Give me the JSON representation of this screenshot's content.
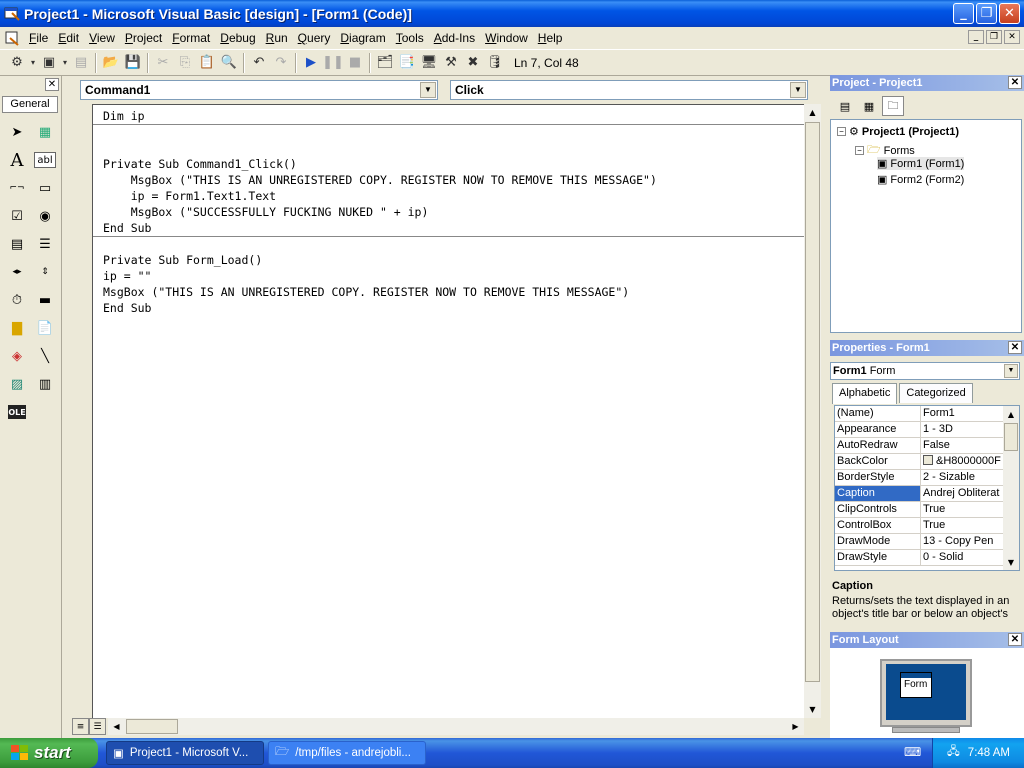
{
  "window": {
    "title": "Project1 - Microsoft Visual Basic [design] - [Form1 (Code)]",
    "min_glyph": "_",
    "max_glyph": "❐",
    "close_glyph": "✕"
  },
  "menu": {
    "items": [
      "File",
      "Edit",
      "View",
      "Project",
      "Format",
      "Debug",
      "Run",
      "Query",
      "Diagram",
      "Tools",
      "Add-Ins",
      "Window",
      "Help"
    ],
    "mdi_min": "_",
    "mdi_restore": "❐",
    "mdi_close": "✕"
  },
  "toolbar": {
    "position": "Ln 7, Col 48"
  },
  "toolbox": {
    "close_glyph": "✕",
    "general_label": "General"
  },
  "code": {
    "object_combo": "Command1",
    "procedure_combo": "Click",
    "lines": [
      "Dim ip",
      "Private Sub Command1_Click()",
      "    MsgBox (\"THIS IS AN UNREGISTERED COPY. REGISTER NOW TO REMOVE THIS MESSAGE\")",
      "    ip = Form1.Text1.Text",
      "    MsgBox (\"SUCCESSFULLY FUCKING NUKED \" + ip)",
      "End Sub",
      "Private Sub Form_Load()",
      "ip = \"\"",
      "MsgBox (\"THIS IS AN UNREGISTERED COPY. REGISTER NOW TO REMOVE THIS MESSAGE\")",
      "End Sub"
    ]
  },
  "project_explorer": {
    "title": "Project - Project1",
    "close_glyph": "✕",
    "root": "Project1 (Project1)",
    "folder": "Forms",
    "items": [
      "Form1 (Form1)",
      "Form2 (Form2)"
    ]
  },
  "properties": {
    "title": "Properties - Form1",
    "close_glyph": "✕",
    "object_name": "Form1",
    "object_type": "Form",
    "tabs": [
      "Alphabetic",
      "Categorized"
    ],
    "rows": [
      {
        "name": "(Name)",
        "value": "Form1"
      },
      {
        "name": "Appearance",
        "value": "1 - 3D"
      },
      {
        "name": "AutoRedraw",
        "value": "False"
      },
      {
        "name": "BackColor",
        "value": "&H8000000F"
      },
      {
        "name": "BorderStyle",
        "value": "2 - Sizable"
      },
      {
        "name": "Caption",
        "value": "Andrej Obliterat"
      },
      {
        "name": "ClipControls",
        "value": "True"
      },
      {
        "name": "ControlBox",
        "value": "True"
      },
      {
        "name": "DrawMode",
        "value": "13 - Copy Pen"
      },
      {
        "name": "DrawStyle",
        "value": "0 - Solid"
      }
    ],
    "selected_row": "Caption",
    "description_title": "Caption",
    "description_text": "Returns/sets the text displayed in an object's title bar or below an object's"
  },
  "form_layout": {
    "title": "Form Layout",
    "close_glyph": "✕",
    "form_label": "Form"
  },
  "taskbar": {
    "start_label": "start",
    "tasks": [
      {
        "label": "Project1 - Microsoft V...",
        "active": true
      },
      {
        "label": "/tmp/files - andrejobli...",
        "active": false
      }
    ],
    "clock": "7:48 AM"
  }
}
